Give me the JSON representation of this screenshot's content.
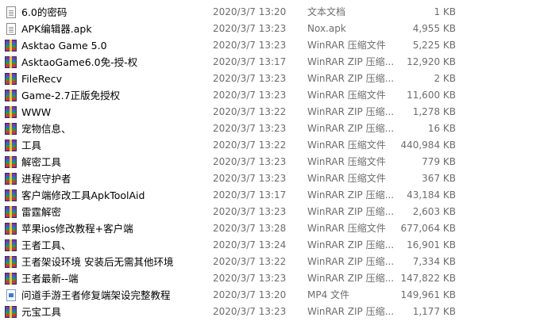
{
  "files": [
    {
      "name": "6.0的密码",
      "date": "2020/3/7 13:20",
      "type": "文本文档",
      "size": "1 KB",
      "icon": "text-file-icon"
    },
    {
      "name": "APK编辑器.apk",
      "date": "2020/3/7 13:23",
      "type": "Nox.apk",
      "size": "4,955 KB",
      "icon": "apk-file-icon"
    },
    {
      "name": "Asktao Game 5.0",
      "date": "2020/3/7 13:23",
      "type": "WinRAR 压缩文件",
      "size": "5,225 KB",
      "icon": "winrar-archive-icon"
    },
    {
      "name": "AsktaoGame6.0免-授-权",
      "date": "2020/3/7 13:17",
      "type": "WinRAR ZIP 压缩...",
      "size": "12,920 KB",
      "icon": "winrar-archive-icon"
    },
    {
      "name": "FileRecv",
      "date": "2020/3/7 13:23",
      "type": "WinRAR ZIP 压缩...",
      "size": "2 KB",
      "icon": "winrar-archive-icon"
    },
    {
      "name": "Game-2.7正版免授权",
      "date": "2020/3/7 13:23",
      "type": "WinRAR 压缩文件",
      "size": "11,600 KB",
      "icon": "winrar-archive-icon"
    },
    {
      "name": "WWW",
      "date": "2020/3/7 13:22",
      "type": "WinRAR ZIP 压缩...",
      "size": "1,278 KB",
      "icon": "winrar-archive-icon"
    },
    {
      "name": "宠物信息、",
      "date": "2020/3/7 13:23",
      "type": "WinRAR ZIP 压缩...",
      "size": "16 KB",
      "icon": "winrar-archive-icon"
    },
    {
      "name": "工具",
      "date": "2020/3/7 13:22",
      "type": "WinRAR 压缩文件",
      "size": "440,984 KB",
      "icon": "winrar-archive-icon"
    },
    {
      "name": "解密工具",
      "date": "2020/3/7 13:23",
      "type": "WinRAR 压缩文件",
      "size": "779 KB",
      "icon": "winrar-archive-icon"
    },
    {
      "name": "进程守护者",
      "date": "2020/3/7 13:23",
      "type": "WinRAR 压缩文件",
      "size": "367 KB",
      "icon": "winrar-archive-icon"
    },
    {
      "name": "客户端修改工具ApkToolAid",
      "date": "2020/3/7 13:17",
      "type": "WinRAR ZIP 压缩...",
      "size": "43,184 KB",
      "icon": "winrar-archive-icon"
    },
    {
      "name": "雷霆解密",
      "date": "2020/3/7 13:23",
      "type": "WinRAR ZIP 压缩...",
      "size": "2,603 KB",
      "icon": "winrar-archive-icon"
    },
    {
      "name": "苹果ios修改教程+客户端",
      "date": "2020/3/7 13:28",
      "type": "WinRAR 压缩文件",
      "size": "677,064 KB",
      "icon": "winrar-archive-icon"
    },
    {
      "name": "王者工具、",
      "date": "2020/3/7 13:24",
      "type": "WinRAR ZIP 压缩...",
      "size": "16,901 KB",
      "icon": "winrar-archive-icon"
    },
    {
      "name": "王者架设环境 安装后无需其他环境",
      "date": "2020/3/7 13:22",
      "type": "WinRAR ZIP 压缩...",
      "size": "7,334 KB",
      "icon": "winrar-archive-icon"
    },
    {
      "name": "王者最新--端",
      "date": "2020/3/7 13:23",
      "type": "WinRAR ZIP 压缩...",
      "size": "147,822 KB",
      "icon": "winrar-archive-icon"
    },
    {
      "name": "问道手游王者修复端架设完整教程",
      "date": "2020/3/7 13:20",
      "type": "MP4 文件",
      "size": "149,961 KB",
      "icon": "mp4-file-icon"
    },
    {
      "name": "元宝工具",
      "date": "2020/3/7 13:23",
      "type": "WinRAR ZIP 压缩...",
      "size": "1,177 KB",
      "icon": "winrar-archive-icon"
    }
  ]
}
